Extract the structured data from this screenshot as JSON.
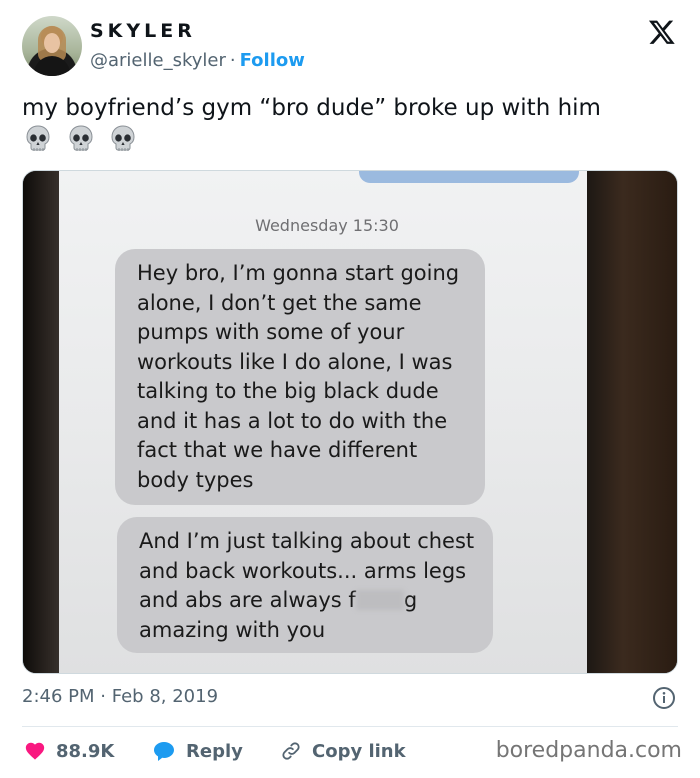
{
  "author": {
    "name": "SKYLER",
    "handle": "@arielle_skyler",
    "separator": "·",
    "follow_label": "Follow"
  },
  "tweet": {
    "text": "my boyfriend’s gym “bro dude” broke up with him",
    "emoji": [
      "skull",
      "skull",
      "skull"
    ]
  },
  "screenshot": {
    "timestamp": "Wednesday 15:30",
    "message1_lines": [
      "Hey bro, I’m gonna start going",
      "alone, I don’t get the same",
      "pumps with some of your",
      "workouts like I do alone, I was",
      "talking to the big black dude",
      "and it has a lot to do with the",
      "fact that we have different",
      "body types"
    ],
    "message2_lines": [
      "And I’m just talking about chest",
      "and back workouts... arms legs",
      "and abs are always f",
      "amazing with you"
    ],
    "message2_line3_end": "g"
  },
  "meta": {
    "time": "2:46 PM",
    "separator": "·",
    "date": "Feb 8, 2019"
  },
  "actions": {
    "likes": "88.9K",
    "reply_label": "Reply",
    "copy_label": "Copy link"
  },
  "watermark": "boredpanda.com",
  "colors": {
    "accent": "#1d9bf0",
    "like": "#f91880",
    "text": "#0f1419",
    "muted": "#536471"
  },
  "icons": [
    "x-logo-icon",
    "info-icon",
    "heart-icon",
    "reply-bubble-icon",
    "link-icon",
    "skull-icon"
  ]
}
